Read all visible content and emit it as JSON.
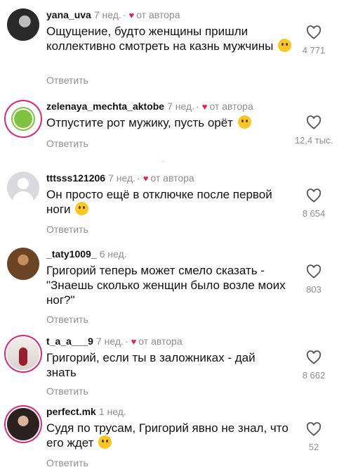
{
  "reply_label": "Ответить",
  "author_badge": "от автора",
  "comments": [
    {
      "username": "yana_uva",
      "age": "7 нед.",
      "by_author": true,
      "text": "Ощущение, будто женщины пришли коллективно смотреть на казнь мужчины",
      "emoji": "sweat-smile",
      "likes": "4 771"
    },
    {
      "username": "zelenaya_mechta_aktobe",
      "age": "7 нед.",
      "by_author": true,
      "text": "Отпустите рот мужику, пусть орёт",
      "emoji": "joy",
      "likes": "12,4 тыс."
    },
    {
      "username": "tttsss121206",
      "age": "7 нед.",
      "by_author": true,
      "text": "Он просто ещё в отключке после первой ноги",
      "emoji": "woozy",
      "likes": "8 654"
    },
    {
      "username": "_taty1009_",
      "age": "6 нед.",
      "by_author": false,
      "text": "Григорий теперь может смело сказать -\"Знаешь сколько женщин было возле моих ног?\"",
      "emoji": "",
      "likes": "803"
    },
    {
      "username": "t_a_a___9",
      "age": "7 нед.",
      "by_author": true,
      "text": "Григорий, если ты в заложниках - дай знать",
      "emoji": "",
      "likes": "8 662"
    },
    {
      "username": "perfect.mk",
      "age": "1 нед.",
      "by_author": false,
      "text": "Судя по трусам, Григорий явно не знал, что его ждет",
      "emoji": "slight-smile",
      "likes": "52"
    }
  ],
  "separator": "..",
  "colors": {
    "heart": "#e0245e",
    "muted": "#8e8e8e",
    "story_ring": "#d62976"
  }
}
